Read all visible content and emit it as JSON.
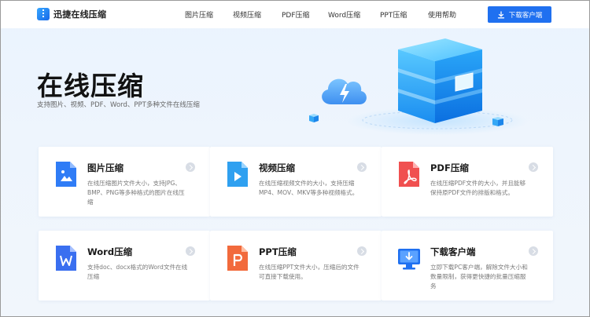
{
  "brand": {
    "name": "迅捷在线压缩"
  },
  "nav": {
    "items": [
      {
        "label": "图片压缩"
      },
      {
        "label": "视频压缩"
      },
      {
        "label": "PDF压缩"
      },
      {
        "label": "Word压缩"
      },
      {
        "label": "PPT压缩"
      },
      {
        "label": "使用帮助"
      }
    ],
    "download_label": "下载客户端"
  },
  "hero": {
    "title": "在线压缩",
    "subtitle": "支持图片、视频、PDF、Word、PPT多种文件在线压缩"
  },
  "cards": [
    {
      "title": "图片压缩",
      "desc": "在线压缩图片文件大小，支持JPG、BMP、PNG等多种格式的图片在线压缩",
      "icon": "image-file-icon",
      "color": "#2f7cf6"
    },
    {
      "title": "视频压缩",
      "desc": "在线压缩视频文件的大小，支持压缩MP4、MOV、MKV等多种视频格式。",
      "icon": "video-file-icon",
      "color": "#2fa0f0"
    },
    {
      "title": "PDF压缩",
      "desc": "在线压缩PDF文件的大小，并且能够保持原PDF文件的排版和格式。",
      "icon": "pdf-file-icon",
      "color": "#f05050"
    },
    {
      "title": "Word压缩",
      "desc": "支持doc、docx格式的Word文件在线压缩",
      "icon": "word-file-icon",
      "color": "#3a6ff0"
    },
    {
      "title": "PPT压缩",
      "desc": "在线压缩PPT文件大小，压缩后的文件可直接下载使用。",
      "icon": "ppt-file-icon",
      "color": "#f26a3c"
    },
    {
      "title": "下载客户端",
      "desc": "立即下载PC客户端，解除文件大小和数量限制，获得更快捷的批量压缩服务",
      "icon": "desktop-download-icon",
      "color": "#1f70f0"
    }
  ]
}
